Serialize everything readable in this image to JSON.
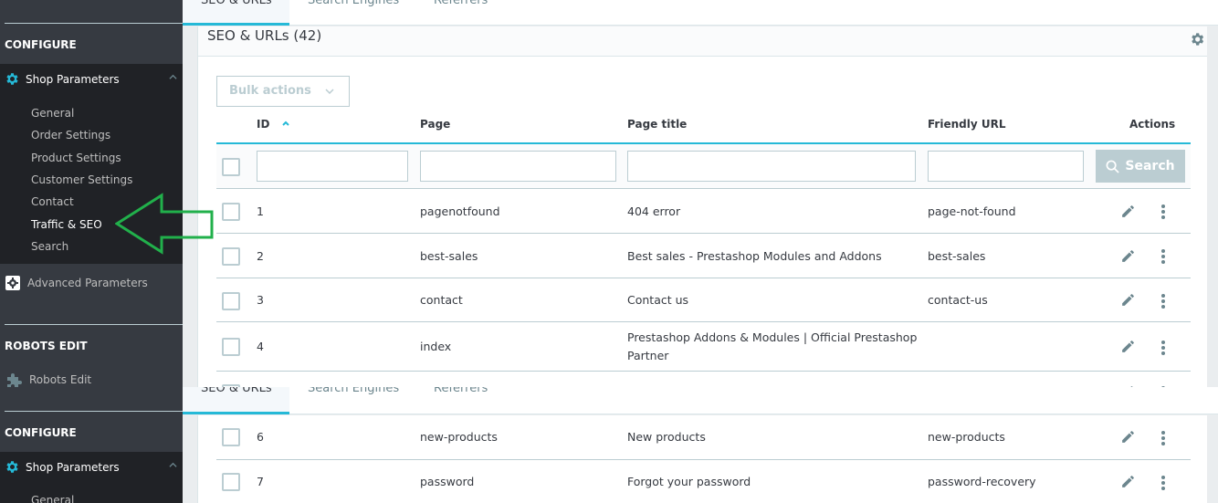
{
  "sidebar": {
    "sections": [
      {
        "title": "CONFIGURE"
      },
      {
        "title": "ROBOTS EDIT"
      }
    ],
    "shop_parameters": {
      "label": "Shop Parameters",
      "icon": "gear-icon",
      "expanded": true,
      "items": [
        {
          "label": "General",
          "active": false
        },
        {
          "label": "Order Settings",
          "active": false
        },
        {
          "label": "Product Settings",
          "active": false
        },
        {
          "label": "Customer Settings",
          "active": false
        },
        {
          "label": "Contact",
          "active": false
        },
        {
          "label": "Traffic & SEO",
          "active": true
        },
        {
          "label": "Search",
          "active": false
        }
      ]
    },
    "advanced_parameters": {
      "label": "Advanced Parameters",
      "icon": "gear-box-icon"
    },
    "robots_edit": {
      "label": "Robots Edit",
      "icon": "puzzle-icon"
    }
  },
  "tabs": [
    {
      "label": "SEO & URLs",
      "active": true
    },
    {
      "label": "Search Engines",
      "active": false
    },
    {
      "label": "Referrers",
      "active": false
    }
  ],
  "card": {
    "title": "SEO & URLs (42)",
    "bulk_actions_label": "Bulk actions",
    "search_button_label": "Search",
    "columns": [
      {
        "key": "id",
        "label": "ID",
        "sort": "ascending"
      },
      {
        "key": "page",
        "label": "Page"
      },
      {
        "key": "page_title",
        "label": "Page title"
      },
      {
        "key": "friendly_url",
        "label": "Friendly URL"
      },
      {
        "key": "actions",
        "label": "Actions"
      }
    ],
    "filters": {
      "id": "",
      "page": "",
      "page_title": "",
      "friendly_url": ""
    },
    "rows": [
      {
        "id": "1",
        "page": "pagenotfound",
        "page_title": "404 error",
        "friendly_url": "page-not-found"
      },
      {
        "id": "2",
        "page": "best-sales",
        "page_title": "Best sales - Prestashop Modules and Addons",
        "friendly_url": "best-sales"
      },
      {
        "id": "3",
        "page": "contact",
        "page_title": "Contact us",
        "friendly_url": "contact-us"
      },
      {
        "id": "4",
        "page": "index",
        "page_title": "Prestashop Addons & Modules | Official Prestashop Partner",
        "friendly_url": ""
      },
      {
        "id": "6",
        "page": "new-products",
        "page_title": "New products",
        "friendly_url": "new-products"
      },
      {
        "id": "7",
        "page": "password",
        "page_title": "Forgot your password",
        "friendly_url": "password-recovery"
      }
    ]
  },
  "colors": {
    "accent": "#25b9d7",
    "sidebar_bg": "#363a41",
    "sidebar_active_bg": "#202226",
    "border": "#bbcdd2",
    "annotation_arrow": "#21b04b"
  }
}
